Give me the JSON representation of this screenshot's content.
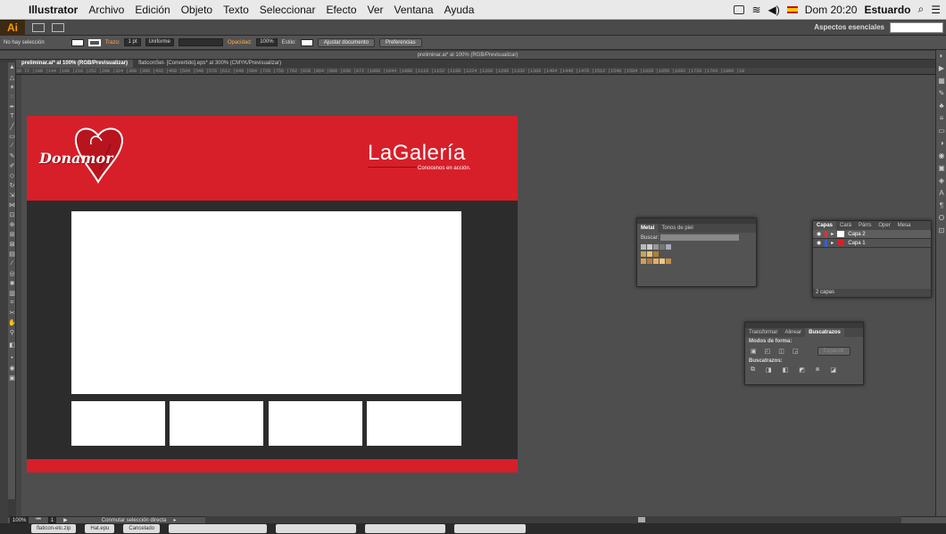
{
  "menubar": {
    "items": [
      "Illustrator",
      "Archivo",
      "Edición",
      "Objeto",
      "Texto",
      "Seleccionar",
      "Efecto",
      "Ver",
      "Ventana",
      "Ayuda"
    ],
    "clock": "Dom 20:20",
    "user": "Estuardo"
  },
  "appbar": {
    "logo": "Ai",
    "workspace": "Aspectos esenciales"
  },
  "control": {
    "selection": "No hay selección",
    "stroke_label": "Trazo:",
    "stroke_value": "1 pt",
    "uniform": "Uniforme",
    "opacity_label": "Opacidad:",
    "opacity_value": "100%",
    "style_label": "Estilo:",
    "fit_doc": "Ajustar documento",
    "prefs": "Preferencias"
  },
  "document": {
    "window_title": "preliminar.ai* al 100% (RGB/Previsualizar)",
    "tabs": [
      "preliminar.ai* al 100% (RGB/Previsualizar)",
      "flaticonSet- [Convertido].eps* al 300% (CMYK/Previsualizar)"
    ],
    "ruler": "36   72  |108 |144 |180 |216 |252 |288 |324 |360 |396 |432 |468 |504 |540 |576 |612 |648 |684 |720 |756 |792 |828 |864 |900 |936 |972 |1008 |1044 |1080 |1116 |1152 |1188 |1224 |1260 |1296 |1332 |1368 |1404 |1440 |1476 |1512 |1548 |1584 |1620 |1656 |1692 |1728 |1764 |1800 |18"
  },
  "artwork": {
    "brand_left": "Donamor",
    "brand_right": "LaGalería",
    "brand_sub": "Conocenos en acción."
  },
  "panels": {
    "swatches": {
      "tabs": [
        "Metal",
        "Tonos de piel"
      ],
      "search_label": "Buscar:"
    },
    "layers": {
      "tabs": [
        "Capas",
        "Cará",
        "Párrs",
        "Oper",
        "Mesa"
      ],
      "layers": [
        "Capa 2",
        "Capa 1"
      ],
      "count": "2 capas"
    },
    "pathfinder": {
      "tabs": [
        "Transformar",
        "Alinear",
        "Buscatrazos"
      ],
      "shape_modes": "Modos de forma:",
      "expand": "Expandir",
      "pathfinders": "Buscatrazos:"
    }
  },
  "status": {
    "zoom": "100%",
    "page": "1",
    "tool": "Conmutar selección directa"
  },
  "dock": {
    "items": [
      "flaticon-etc.zip",
      "Hat.epu",
      "Cancelado",
      "",
      "",
      "",
      ""
    ]
  },
  "colors": {
    "brand_red": "#d71f2a",
    "canvas": "#4e4e4e",
    "panel": "#535353"
  }
}
